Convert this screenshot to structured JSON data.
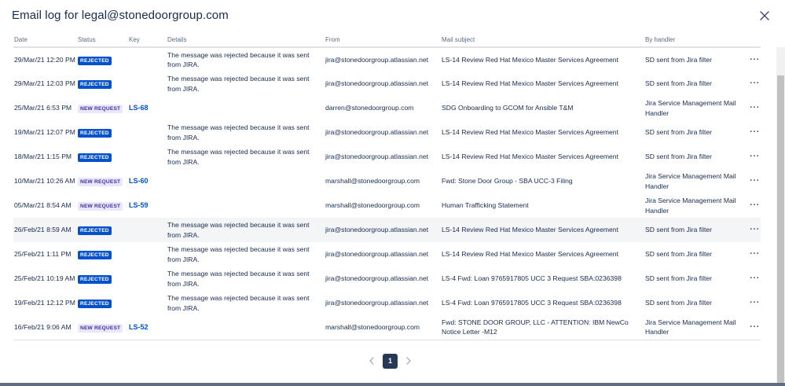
{
  "dialog": {
    "title": "Email log for legal@stonedoorgroup.com",
    "close_icon": "close-icon"
  },
  "table": {
    "headers": [
      "Date",
      "Status",
      "Key",
      "Details",
      "From",
      "Mail subject",
      "By handler"
    ],
    "rows": [
      {
        "date": "29/Mar/21 12:20 PM",
        "status": "REJECTED",
        "key": "",
        "details": "The message was rejected because it was sent from JIRA.",
        "from": "jira@stonedoorgroup.atlassian.net",
        "subject": "LS-14 Review Red Hat Mexico Master Services Agreement",
        "handler": "SD sent from Jira filter"
      },
      {
        "date": "29/Mar/21 12:03 PM",
        "status": "REJECTED",
        "key": "",
        "details": "The message was rejected because it was sent from JIRA.",
        "from": "jira@stonedoorgroup.atlassian.net",
        "subject": "LS-14 Review Red Hat Mexico Master Services Agreement",
        "handler": "SD sent from Jira filter"
      },
      {
        "date": "25/Mar/21 6:53 PM",
        "status": "NEW REQUEST",
        "key": "LS-68",
        "details": "",
        "from": "darren@stonedoorgroup.com",
        "subject": "SDG Onboarding to GCOM for Ansible T&M",
        "handler": "Jira Service Management Mail Handler"
      },
      {
        "date": "19/Mar/21 12:07 PM",
        "status": "REJECTED",
        "key": "",
        "details": "The message was rejected because it was sent from JIRA.",
        "from": "jira@stonedoorgroup.atlassian.net",
        "subject": "LS-14 Review Red Hat Mexico Master Services Agreement",
        "handler": "SD sent from Jira filter"
      },
      {
        "date": "18/Mar/21 1:15 PM",
        "status": "REJECTED",
        "key": "",
        "details": "The message was rejected because it was sent from JIRA.",
        "from": "jira@stonedoorgroup.atlassian.net",
        "subject": "LS-14 Review Red Hat Mexico Master Services Agreement",
        "handler": "SD sent from Jira filter"
      },
      {
        "date": "10/Mar/21 10:26 AM",
        "status": "NEW REQUEST",
        "key": "LS-60",
        "details": "",
        "from": "marshall@stonedoorgroup.com",
        "subject": "Fwd: Stone Door Group - SBA UCC-3 Filing",
        "handler": "Jira Service Management Mail Handler"
      },
      {
        "date": "05/Mar/21 8:54 AM",
        "status": "NEW REQUEST",
        "key": "LS-59",
        "details": "",
        "from": "marshall@stonedoorgroup.com",
        "subject": "Human Trafficking Statement",
        "handler": "Jira Service Management Mail Handler"
      },
      {
        "date": "26/Feb/21 8:59 AM",
        "status": "REJECTED",
        "key": "",
        "details": "The message was rejected because it was sent from JIRA.",
        "from": "jira@stonedoorgroup.atlassian.net",
        "subject": "LS-14 Review Red Hat Mexico Master Services Agreement",
        "handler": "SD sent from Jira filter",
        "highlight": true
      },
      {
        "date": "25/Feb/21 1:11 PM",
        "status": "REJECTED",
        "key": "",
        "details": "The message was rejected because it was sent from JIRA.",
        "from": "jira@stonedoorgroup.atlassian.net",
        "subject": "LS-14 Review Red Hat Mexico Master Services Agreement",
        "handler": "SD sent from Jira filter"
      },
      {
        "date": "25/Feb/21 10:19 AM",
        "status": "REJECTED",
        "key": "",
        "details": "The message was rejected because it was sent from JIRA.",
        "from": "jira@stonedoorgroup.atlassian.net",
        "subject": "LS-4 Fwd: Loan 9765917805 UCC 3 Request SBA:0236398",
        "handler": "SD sent from Jira filter"
      },
      {
        "date": "19/Feb/21 12:12 PM",
        "status": "REJECTED",
        "key": "",
        "details": "The message was rejected because it was sent from JIRA.",
        "from": "jira@stonedoorgroup.atlassian.net",
        "subject": "LS-4 Fwd: Loan 9765917805 UCC 3 Request SBA:0236398",
        "handler": "SD sent from Jira filter"
      },
      {
        "date": "16/Feb/21 9:06 AM",
        "status": "NEW REQUEST",
        "key": "LS-52",
        "details": "",
        "from": "marshall@stonedoorgroup.com",
        "subject": "Fwd: STONE DOOR GROUP, LLC - ATTENTION: IBM NewCo Notice Letter -M12",
        "handler": "Jira Service Management Mail Handler"
      }
    ],
    "row_action_label": "···"
  },
  "pagination": {
    "current_page": "1",
    "prev_icon": "chevron-left-icon",
    "next_icon": "chevron-right-icon"
  },
  "colors": {
    "rejected": "#0052cc",
    "new_request_bg": "#eae6ff",
    "new_request_text": "#403294",
    "link": "#0052cc",
    "current_page": "#253858"
  }
}
